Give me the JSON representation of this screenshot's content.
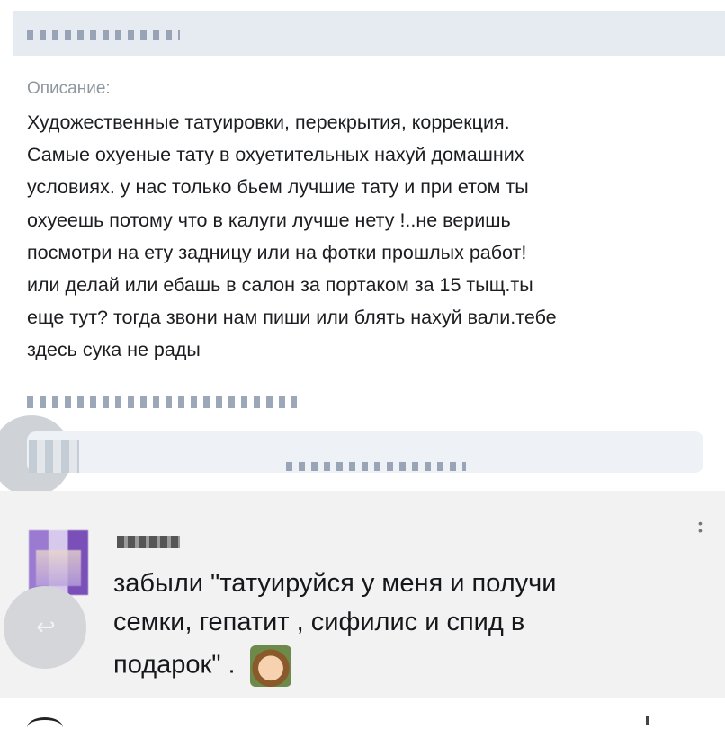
{
  "post": {
    "description_label": "Описание:",
    "description_text": "Художественные татуировки, перекрытия, коррекция.\nСамые охуеные тату в охуетительных нахуй домашних\nусловиях. у нас только бьем лучшие тату и при етом ты\nохуеешь потому что в калуги лучше нету !..не веришь\nпосмотри на ету задницу или на фотки прошлых работ!\nили делай или ебашь в салон за портаком за 15 тыщ.ты\nеще тут? тогда звони нам пиши или блять нахуй вали.тебе\nздесь сука не рады"
  },
  "comment": {
    "text_line1": "забыли \"татуируйся у меня и получи",
    "text_line2": "семки, гепатит , сифилис и спид в",
    "text_line3": "подарок\" .",
    "emoji": "kid-laughing-emoji",
    "more_icon": "more-vertical-icon"
  },
  "icons": {
    "reply": "reply-icon",
    "avatar": "avatar"
  },
  "colors": {
    "header_bg": "#e6ebf1",
    "comment_bg": "#f2f2f2",
    "label": "#8f969e",
    "text": "#1b1d20"
  }
}
